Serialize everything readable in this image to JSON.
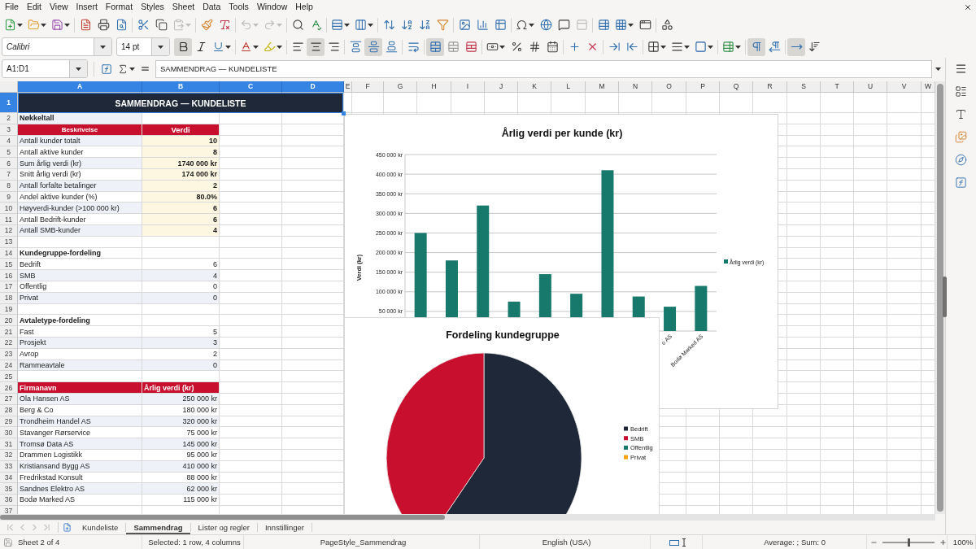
{
  "menu_bar": {
    "items": [
      "File",
      "Edit",
      "View",
      "Insert",
      "Format",
      "Styles",
      "Sheet",
      "Data",
      "Tools",
      "Window",
      "Help"
    ]
  },
  "standard_toolbar": {
    "groups": [
      [
        {
          "kind": "new-document",
          "caret": true,
          "disabled": false
        },
        {
          "kind": "open",
          "caret": true,
          "disabled": false
        },
        {
          "kind": "save",
          "caret": true,
          "disabled": false
        }
      ],
      [
        {
          "kind": "export-pdf",
          "caret": false,
          "disabled": false
        },
        {
          "kind": "print",
          "caret": false,
          "disabled": false
        },
        {
          "kind": "print-preview",
          "caret": false,
          "disabled": false
        }
      ],
      [
        {
          "kind": "cut",
          "caret": false,
          "disabled": false
        },
        {
          "kind": "copy",
          "caret": false,
          "disabled": false
        },
        {
          "kind": "paste",
          "caret": true,
          "disabled": true
        }
      ],
      [
        {
          "kind": "clone-formatting",
          "caret": false,
          "disabled": false
        },
        {
          "kind": "clear-formatting",
          "caret": false,
          "disabled": false
        }
      ],
      [
        {
          "kind": "undo",
          "caret": true,
          "disabled": true
        },
        {
          "kind": "redo",
          "caret": true,
          "disabled": true
        }
      ],
      [
        {
          "kind": "find-replace",
          "caret": false,
          "disabled": false
        },
        {
          "kind": "spelling",
          "caret": false,
          "disabled": false
        }
      ],
      [
        {
          "kind": "rows",
          "caret": true,
          "disabled": false
        },
        {
          "kind": "columns",
          "caret": true,
          "disabled": false
        }
      ],
      [
        {
          "kind": "sort",
          "caret": false,
          "disabled": false
        },
        {
          "kind": "sort-ascending",
          "caret": false,
          "disabled": false
        },
        {
          "kind": "sort-descending",
          "caret": false,
          "disabled": false
        },
        {
          "kind": "autofilter",
          "caret": false,
          "disabled": false
        }
      ],
      [
        {
          "kind": "image",
          "caret": false,
          "disabled": false
        },
        {
          "kind": "chart",
          "caret": false,
          "disabled": false
        },
        {
          "kind": "pivot-table",
          "caret": false,
          "disabled": false
        }
      ],
      [
        {
          "kind": "special-character",
          "caret": true,
          "disabled": false
        },
        {
          "kind": "hyperlink",
          "caret": false,
          "disabled": false
        },
        {
          "kind": "comment",
          "caret": false,
          "disabled": false
        },
        {
          "kind": "header-footer",
          "caret": false,
          "disabled": true
        }
      ],
      [
        {
          "kind": "print-area",
          "caret": false,
          "disabled": false
        },
        {
          "kind": "freeze",
          "caret": true,
          "disabled": false
        },
        {
          "kind": "split-window",
          "caret": false,
          "disabled": false
        }
      ],
      [
        {
          "kind": "draw-functions",
          "caret": false,
          "disabled": false
        }
      ]
    ]
  },
  "formatting_toolbar": {
    "font_name": "Calibri",
    "font_size": "14 pt",
    "groups": [
      [
        {
          "kind": "bold",
          "active": true,
          "caret": false
        },
        {
          "kind": "italic",
          "active": false,
          "caret": false
        },
        {
          "kind": "underline",
          "active": false,
          "caret": true
        }
      ],
      [
        {
          "kind": "font-color",
          "active": false,
          "caret": true
        },
        {
          "kind": "highlight",
          "active": false,
          "caret": true
        }
      ],
      [
        {
          "kind": "align-left",
          "active": false,
          "caret": false
        },
        {
          "kind": "align-center",
          "active": true,
          "caret": false
        },
        {
          "kind": "align-right",
          "active": false,
          "caret": false
        }
      ],
      [
        {
          "kind": "align-top",
          "active": false,
          "caret": false
        },
        {
          "kind": "align-middle",
          "active": true,
          "caret": false
        },
        {
          "kind": "align-bottom",
          "active": false,
          "caret": false
        }
      ],
      [
        {
          "kind": "wrap-text",
          "active": false,
          "caret": false
        }
      ],
      [
        {
          "kind": "merge-center",
          "active": true,
          "caret": false
        },
        {
          "kind": "merge-cells",
          "active": false,
          "caret": false
        },
        {
          "kind": "unmerge-cells",
          "active": false,
          "caret": false
        }
      ],
      [
        {
          "kind": "currency",
          "active": false,
          "caret": true
        },
        {
          "kind": "percent",
          "active": false,
          "caret": false
        },
        {
          "kind": "number",
          "active": false,
          "caret": false
        },
        {
          "kind": "date",
          "active": false,
          "caret": false
        }
      ],
      [
        {
          "kind": "add-decimal",
          "active": false,
          "caret": false
        },
        {
          "kind": "delete-decimal",
          "active": false,
          "caret": false
        }
      ],
      [
        {
          "kind": "indent-increase",
          "active": false,
          "caret": false
        },
        {
          "kind": "indent-decrease",
          "active": false,
          "caret": false
        }
      ],
      [
        {
          "kind": "borders",
          "active": false,
          "caret": true
        },
        {
          "kind": "border-style",
          "active": false,
          "caret": true
        },
        {
          "kind": "border-color",
          "active": false,
          "caret": true
        }
      ],
      [
        {
          "kind": "conditional",
          "active": false,
          "caret": true
        }
      ],
      [
        {
          "kind": "left-to-right",
          "active": true,
          "caret": false
        },
        {
          "kind": "right-to-left",
          "active": false,
          "caret": false
        }
      ],
      [
        {
          "kind": "text-left-to-right",
          "active": true,
          "caret": false
        },
        {
          "kind": "text-top-to-bottom",
          "active": false,
          "caret": false
        }
      ]
    ]
  },
  "formula_bar": {
    "name_box": "A1:D1",
    "content": "SAMMENDRAG — KUNDELISTE"
  },
  "sheet": {
    "columns": [
      {
        "label": "A",
        "selected": true
      },
      {
        "label": "B",
        "selected": true
      },
      {
        "label": "C",
        "selected": true
      },
      {
        "label": "D",
        "selected": true
      },
      {
        "label": "E",
        "selected": false
      },
      {
        "label": "F",
        "selected": false
      },
      {
        "label": "G",
        "selected": false
      },
      {
        "label": "H",
        "selected": false
      },
      {
        "label": "I",
        "selected": false
      },
      {
        "label": "J",
        "selected": false
      },
      {
        "label": "K",
        "selected": false
      },
      {
        "label": "L",
        "selected": false
      },
      {
        "label": "M",
        "selected": false
      },
      {
        "label": "N",
        "selected": false
      },
      {
        "label": "O",
        "selected": false
      },
      {
        "label": "P",
        "selected": false
      },
      {
        "label": "Q",
        "selected": false
      },
      {
        "label": "R",
        "selected": false
      },
      {
        "label": "S",
        "selected": false
      },
      {
        "label": "T",
        "selected": false
      },
      {
        "label": "U",
        "selected": false
      },
      {
        "label": "V",
        "selected": false
      },
      {
        "label": "W",
        "selected": false
      }
    ],
    "rows": [
      {
        "number": "1",
        "selected": true,
        "kind": "title",
        "cells": [
          "SAMMENDRAG — KUNDELISTE"
        ]
      },
      {
        "number": "2",
        "selected": false,
        "kind": "section",
        "shaded": true,
        "cells": [
          "Nøkkeltall"
        ]
      },
      {
        "number": "3",
        "selected": false,
        "kind": "key_header",
        "cells": [
          "Beskrivelse",
          "Verdi"
        ]
      },
      {
        "number": "4",
        "selected": false,
        "kind": "metric",
        "shaded": true,
        "cells": [
          "Antall kunder totalt",
          "10"
        ]
      },
      {
        "number": "5",
        "selected": false,
        "kind": "metric",
        "shaded": false,
        "cells": [
          "Antall aktive kunder",
          "8"
        ]
      },
      {
        "number": "6",
        "selected": false,
        "kind": "metric",
        "shaded": true,
        "cells": [
          "Sum årlig verdi (kr)",
          "1740 000 kr"
        ]
      },
      {
        "number": "7",
        "selected": false,
        "kind": "metric",
        "shaded": false,
        "cells": [
          "Snitt årlig verdi (kr)",
          "174 000 kr"
        ]
      },
      {
        "number": "8",
        "selected": false,
        "kind": "metric",
        "shaded": true,
        "cells": [
          "Antall forfalte betalinger",
          "2"
        ]
      },
      {
        "number": "9",
        "selected": false,
        "kind": "metric",
        "shaded": false,
        "cells": [
          "Andel aktive kunder (%)",
          "80.0%"
        ]
      },
      {
        "number": "10",
        "selected": false,
        "kind": "metric",
        "shaded": true,
        "cells": [
          "Høyverdi-kunder (>100 000 kr)",
          "6"
        ]
      },
      {
        "number": "11",
        "selected": false,
        "kind": "metric",
        "shaded": false,
        "cells": [
          "Antall Bedrift-kunder",
          "6"
        ]
      },
      {
        "number": "12",
        "selected": false,
        "kind": "metric",
        "shaded": true,
        "cells": [
          "Antall SMB-kunder",
          "4"
        ]
      },
      {
        "number": "13",
        "selected": false,
        "kind": "blank"
      },
      {
        "number": "14",
        "selected": false,
        "kind": "section",
        "shaded": false,
        "cells": [
          "Kundegruppe-fordeling"
        ]
      },
      {
        "number": "15",
        "selected": false,
        "kind": "count",
        "shaded": false,
        "cells": [
          "Bedrift",
          "6"
        ]
      },
      {
        "number": "16",
        "selected": false,
        "kind": "count",
        "shaded": true,
        "cells": [
          "SMB",
          "4"
        ]
      },
      {
        "number": "17",
        "selected": false,
        "kind": "count",
        "shaded": false,
        "cells": [
          "Offentlig",
          "0"
        ]
      },
      {
        "number": "18",
        "selected": false,
        "kind": "count",
        "shaded": true,
        "cells": [
          "Privat",
          "0"
        ]
      },
      {
        "number": "19",
        "selected": false,
        "kind": "blank"
      },
      {
        "number": "20",
        "selected": false,
        "kind": "section",
        "shaded": false,
        "cells": [
          "Avtaletype-fordeling"
        ]
      },
      {
        "number": "21",
        "selected": false,
        "kind": "count",
        "shaded": false,
        "cells": [
          "Fast",
          "5"
        ]
      },
      {
        "number": "22",
        "selected": false,
        "kind": "count",
        "shaded": true,
        "cells": [
          "Prosjekt",
          "3"
        ]
      },
      {
        "number": "23",
        "selected": false,
        "kind": "count",
        "shaded": false,
        "cells": [
          "Avrop",
          "2"
        ]
      },
      {
        "number": "24",
        "selected": false,
        "kind": "count",
        "shaded": true,
        "cells": [
          "Rammeavtale",
          "0"
        ]
      },
      {
        "number": "25",
        "selected": false,
        "kind": "blank"
      },
      {
        "number": "26",
        "selected": false,
        "kind": "table_header",
        "cells": [
          "Firmanavn",
          "Årlig verdi (kr)"
        ]
      },
      {
        "number": "27",
        "selected": false,
        "kind": "count",
        "shaded": true,
        "cells": [
          "Ola Hansen AS",
          "250 000 kr"
        ]
      },
      {
        "number": "28",
        "selected": false,
        "kind": "count",
        "shaded": false,
        "cells": [
          "Berg & Co",
          "180 000 kr"
        ]
      },
      {
        "number": "29",
        "selected": false,
        "kind": "count",
        "shaded": true,
        "cells": [
          "Trondheim Handel AS",
          "320 000 kr"
        ]
      },
      {
        "number": "30",
        "selected": false,
        "kind": "count",
        "shaded": false,
        "cells": [
          "Stavanger Rørservice",
          "75 000 kr"
        ]
      },
      {
        "number": "31",
        "selected": false,
        "kind": "count",
        "shaded": true,
        "cells": [
          "Tromsø Data AS",
          "145 000 kr"
        ]
      },
      {
        "number": "32",
        "selected": false,
        "kind": "count",
        "shaded": false,
        "cells": [
          "Drammen Logistikk",
          "95 000 kr"
        ]
      },
      {
        "number": "33",
        "selected": false,
        "kind": "count",
        "shaded": true,
        "cells": [
          "Kristiansand Bygg AS",
          "410 000 kr"
        ]
      },
      {
        "number": "34",
        "selected": false,
        "kind": "count",
        "shaded": false,
        "cells": [
          "Fredrikstad Konsult",
          "88 000 kr"
        ]
      },
      {
        "number": "35",
        "selected": false,
        "kind": "count",
        "shaded": true,
        "cells": [
          "Sandnes Elektro AS",
          "62 000 kr"
        ]
      },
      {
        "number": "36",
        "selected": false,
        "kind": "count",
        "shaded": false,
        "cells": [
          "Bodø Marked AS",
          "115 000 kr"
        ]
      },
      {
        "number": "37",
        "selected": false,
        "kind": "blank"
      }
    ]
  },
  "bar_chart": {
    "chart_data": {
      "type": "bar",
      "title": "Årlig verdi per kunde (kr)",
      "ylabel": "Verdi (kr)",
      "ylim": [
        0,
        450000
      ],
      "yticks": [
        {
          "value": 50000,
          "label": "50 000 kr"
        },
        {
          "value": 100000,
          "label": "100 000 kr"
        },
        {
          "value": 150000,
          "label": "150 000 kr"
        },
        {
          "value": 200000,
          "label": "200 000 kr"
        },
        {
          "value": 250000,
          "label": "250 000 kr"
        },
        {
          "value": 300000,
          "label": "300 000 kr"
        },
        {
          "value": 350000,
          "label": "350 000 kr"
        },
        {
          "value": 400000,
          "label": "400 000 kr"
        },
        {
          "value": 450000,
          "label": "450 000 kr"
        }
      ],
      "grid": true,
      "legend": true,
      "series": [
        {
          "name": "Årlig verdi (kr)",
          "color": "#17786c",
          "values": [
            250000,
            180000,
            320000,
            75000,
            145000,
            95000,
            410000,
            88000,
            62000,
            115000
          ]
        }
      ]
    },
    "x_axis_labels": [
      "o AS",
      "Bodø Marked AS"
    ]
  },
  "pie_chart": {
    "chart_data": {
      "type": "pie",
      "title": "Fordeling kundegruppe",
      "categories": [
        "Bedrift",
        "SMB",
        "Offentlig",
        "Privat"
      ],
      "values": [
        60,
        40,
        0,
        0
      ],
      "colors": [
        "#1e2838",
        "#c8102e",
        "#17786c",
        "#f0a30a"
      ],
      "legend": true
    }
  },
  "sheet_tabs": [
    {
      "label": "Kundeliste",
      "selected": false
    },
    {
      "label": "Sammendrag",
      "selected": true
    },
    {
      "label": "Lister og regler",
      "selected": false
    },
    {
      "label": "Innstillinger",
      "selected": false
    }
  ],
  "status_bar": {
    "sheet_position": "Sheet 2 of 4",
    "selection": "Selected: 1 row, 4 columns",
    "page_style": "PageStyle_Sammendrag",
    "language": "English (USA)",
    "summary": "Average: ; Sum: 0",
    "zoom": {
      "level": 0.5,
      "label": "100%"
    }
  }
}
